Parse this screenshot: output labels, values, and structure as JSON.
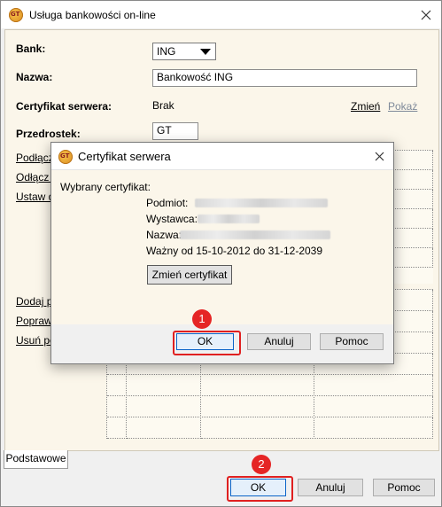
{
  "main": {
    "title": "Usługa bankowości on-line",
    "app_icon_text": "GT",
    "labels": {
      "bank": "Bank:",
      "nazwa": "Nazwa:",
      "certyfikat": "Certyfikat serwera:",
      "przedrostek": "Przedrostek:"
    },
    "bank_value": "ING",
    "nazwa_value": "Bankowość ING",
    "certyfikat_value": "Brak",
    "zmien_link": "Zmień",
    "pokaz_link": "Pokaż",
    "przedrostek_value": "GT",
    "left_links_top": [
      "Podłącz",
      "Odłącz r",
      "Ustaw d"
    ],
    "left_links_bottom": [
      "Dodaj pe",
      "Popraw p",
      "Usuń pe"
    ],
    "tab_label": "Podstawowe",
    "buttons": {
      "ok": "OK",
      "anuluj": "Anuluj",
      "pomoc": "Pomoc"
    },
    "badge": "2"
  },
  "dialog": {
    "title": "Certyfikat serwera",
    "section_label": "Wybrany certyfikat:",
    "fields": {
      "podmiot": "Podmiot:",
      "wystawca": "Wystawca:",
      "nazwa": "Nazwa:"
    },
    "validity": "Ważny od 15-10-2012 do 31-12-2039",
    "change_button": "Zmień certyfikat",
    "buttons": {
      "ok": "OK",
      "anuluj": "Anuluj",
      "pomoc": "Pomoc"
    },
    "badge": "1"
  },
  "colors": {
    "highlight": "#e02020",
    "panel_bg": "#fbf6ea"
  }
}
